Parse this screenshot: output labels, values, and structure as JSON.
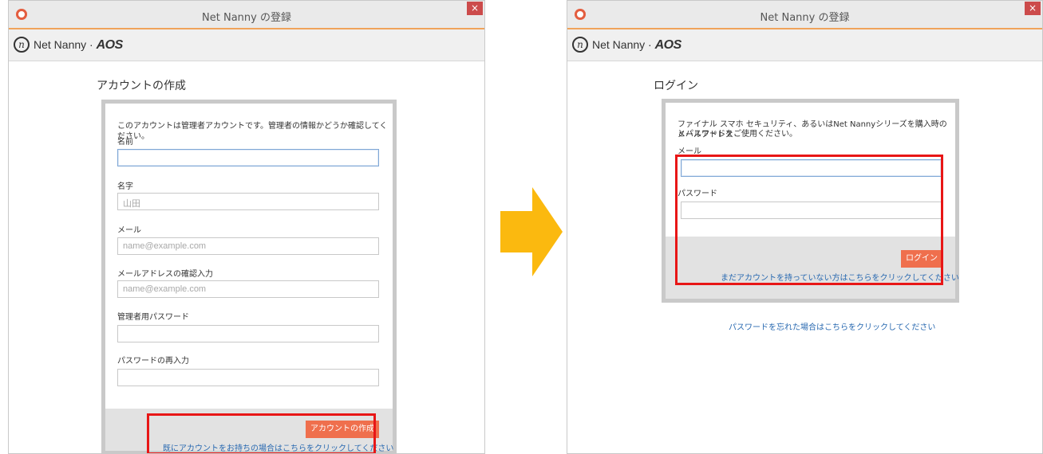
{
  "window_title": "Net Nanny の登録",
  "close_glyph": "×",
  "brand": {
    "name": "Net Nanny ·",
    "partner": "AOS",
    "logo_glyph": "n"
  },
  "left": {
    "heading": "アカウントの作成",
    "notice": "このアカウントは管理者アカウントです。管理者の情報かどうか確認してください。",
    "fields": [
      {
        "label": "名前",
        "value": "",
        "placeholder": ""
      },
      {
        "label": "名字",
        "value": "",
        "placeholder": "山田"
      },
      {
        "label": "メール",
        "value": "",
        "placeholder": "name@example.com"
      },
      {
        "label": "メールアドレスの確認入力",
        "value": "",
        "placeholder": "name@example.com"
      },
      {
        "label": "管理者用パスワード",
        "value": "",
        "placeholder": ""
      },
      {
        "label": "パスワードの再入力",
        "value": "",
        "placeholder": ""
      }
    ],
    "submit_label": "アカウントの作成",
    "link_text": "既にアカウントをお持ちの場合はこちらをクリックしてください"
  },
  "right": {
    "heading": "ログイン",
    "notice_line1": "ファイナル スマホ セキュリティ、あるいはNet Nannyシリーズを購入時の メールアドレス",
    "notice_line2": "とパスワードをご使用ください。",
    "fields": [
      {
        "label": "メール",
        "value": "",
        "placeholder": ""
      },
      {
        "label": "パスワード",
        "value": "",
        "placeholder": ""
      }
    ],
    "submit_label": "ログイン",
    "link_text": "まだアカウントを持っていない方はこちらをクリックしてください",
    "forgot_text": "パスワードを忘れた場合はこちらをクリックしてください"
  },
  "colors": {
    "accent": "#ef6f4d",
    "link": "#2a6ab1",
    "highlight": "#e81616",
    "arrow": "#fbb90f"
  },
  "icons": [
    "app-icon",
    "close-icon",
    "net-nanny-logo-icon",
    "right-arrow-icon"
  ]
}
